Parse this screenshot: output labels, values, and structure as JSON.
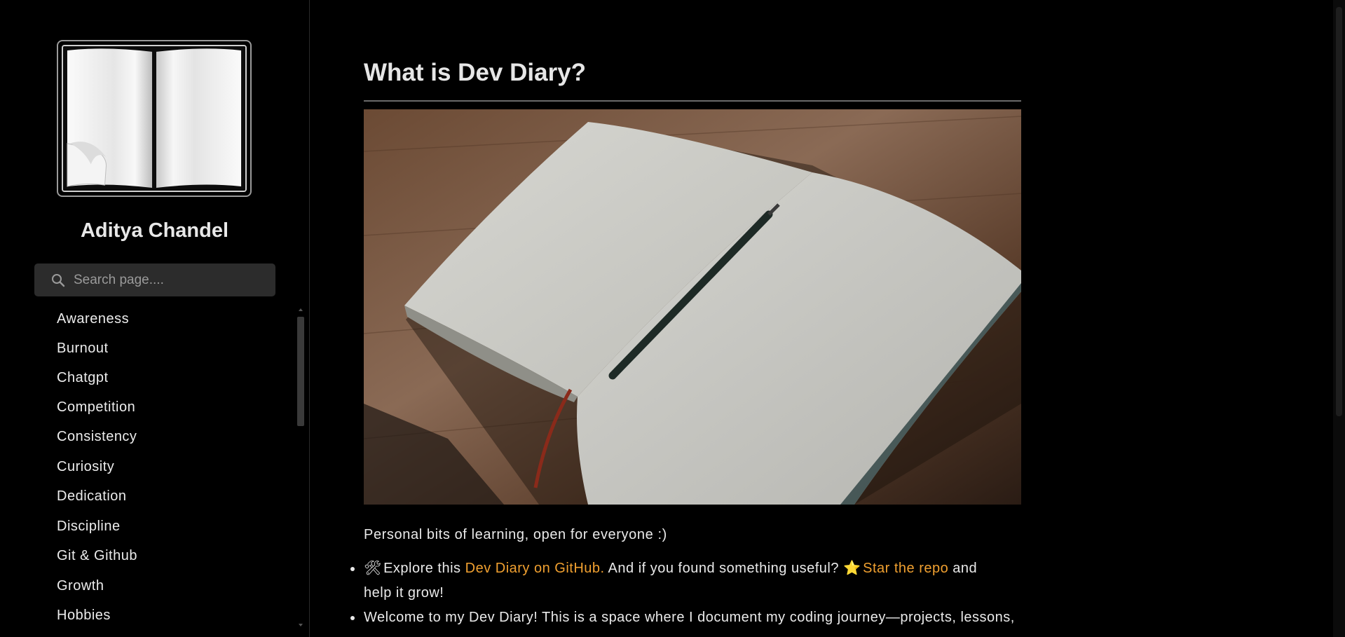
{
  "sidebar": {
    "author_name": "Aditya Chandel",
    "search": {
      "placeholder": "Search page...."
    },
    "nav_items": [
      "Awareness",
      "Burnout",
      "Chatgpt",
      "Competition",
      "Consistency",
      "Curiosity",
      "Dedication",
      "Discipline",
      "Git & Github",
      "Growth",
      "Hobbies"
    ]
  },
  "main": {
    "title": "What is Dev Diary?",
    "tagline": "Personal bits of learning, open for everyone :)",
    "bullet1": {
      "icon": "🛠",
      "text_before": "Explore this",
      "link1": "Dev Diary on GitHub.",
      "text_middle": "And if you found something useful?",
      "star": "⭐",
      "link2": "Star the repo",
      "text_after": "and",
      "text_wrap": "help it grow!"
    },
    "bullet2": {
      "text": "Welcome to my Dev Diary! This is a space where I document my coding journey—projects, lessons,"
    }
  },
  "colors": {
    "background": "#000000",
    "link": "#f0a030",
    "text": "#e6e6e6"
  }
}
